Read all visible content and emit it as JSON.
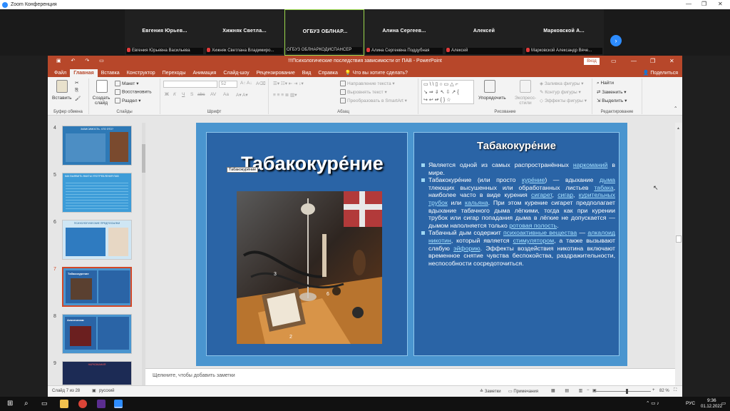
{
  "zoom": {
    "title": "Zoom Конференция",
    "participants": [
      {
        "name": "Евгения  Юрьев...",
        "label": "Евгения Юрьевна Васильева"
      },
      {
        "name": "Хижняк  Светла...",
        "label": "Хижняк Светлана Владимиро..."
      },
      {
        "name": "ОГБУЗ  ОБЛНАР...",
        "label": "ОГБУЗ ОБЛНАРКОДИСПАНСЕР"
      },
      {
        "name": "Алина  Сергеев...",
        "label": "Алина Сергеевна Поддубная"
      },
      {
        "name": "Алексей",
        "label": "Алексей"
      },
      {
        "name": "Марковской  А...",
        "label": "Марковской Александр Вяче..."
      }
    ],
    "next_icon": "chevron-right-icon"
  },
  "ppt": {
    "window_title": "!!!Психологические последствия зависимости от ПАВ  -  PowerPoint",
    "login": "Вход",
    "tabs": [
      "Файл",
      "Главная",
      "Вставка",
      "Конструктор",
      "Переходы",
      "Анимация",
      "Слайд-шоу",
      "Рецензирование",
      "Вид",
      "Справка"
    ],
    "tell_me": "Что вы хотите сделать?",
    "share": "Поделиться",
    "ribbon": {
      "clipboard": {
        "paste": "Вставить",
        "label": "Буфер обмена"
      },
      "slides": {
        "create": "Создать слайд",
        "layout": "Макет",
        "reset": "Восстановить",
        "section": "Раздел",
        "label": "Слайды"
      },
      "font": {
        "size": "52",
        "label": "Шрифт",
        "buttons": [
          "Ж",
          "К",
          "Ч",
          "S",
          "abc",
          "AV",
          "Aa"
        ]
      },
      "paragraph": {
        "direction": "Направление текста",
        "align": "Выровнять текст",
        "smartart": "Преобразовать в SmartArt",
        "label": "Абзац"
      },
      "drawing": {
        "arrange": "Упорядочить",
        "styles": "Экспресс-стили",
        "fill": "Заливка фигуры",
        "outline": "Контур фигуры",
        "effects": "Эффекты фигуры",
        "label": "Рисование"
      },
      "editing": {
        "find": "Найти",
        "replace": "Заменить",
        "select": "Выделить",
        "label": "Редактирование"
      }
    },
    "thumbnails": [
      {
        "num": "4",
        "title": "ЗАВИСИМОСТЬ. ЧТО ЭТО?"
      },
      {
        "num": "5",
        "title": "КАК ВЫЯВИТЬ ФАКТЫ УПОТРЕБЛЕНИЯ ПАВ"
      },
      {
        "num": "6",
        "title": "ПСИХОЛОГИЧЕСКИЕ ПРЕДПОСЫЛКИ"
      },
      {
        "num": "7",
        "title": "Табакокурение"
      },
      {
        "num": "8",
        "title": "Алкоголизм"
      },
      {
        "num": "9",
        "title": "НАРКОМАНИЯ"
      }
    ],
    "slide": {
      "title": "Табакокуре́ние",
      "tooltip": "Табакокуре́ние",
      "right_title": "Табакокуре́ние",
      "bullets": [
        [
          {
            "t": "Является одной из самых распространённых "
          },
          {
            "t": "наркоманий",
            "l": true
          },
          {
            "t": " в мире."
          }
        ],
        [
          {
            "t": "Табакокуре́ние (или просто "
          },
          {
            "t": "куре́ние",
            "l": true
          },
          {
            "t": ") — вдыхание "
          },
          {
            "t": "дыма",
            "l": true
          },
          {
            "t": " тлеющих высушенных или обработанных листьев "
          },
          {
            "t": "табака",
            "l": true
          },
          {
            "t": ", наиболее часто в виде курения "
          },
          {
            "t": "сигарет",
            "l": true
          },
          {
            "t": ", "
          },
          {
            "t": "сигар",
            "l": true
          },
          {
            "t": ", "
          },
          {
            "t": "курительных трубок",
            "l": true
          },
          {
            "t": " или "
          },
          {
            "t": "кальяна",
            "l": true
          },
          {
            "t": ". При этом курение сигарет предполагает вдыхание табачного дыма лёгкими, тогда как при курении трубок или сигар попадания дыма в лёгкие не допускается — дымом наполняется только "
          },
          {
            "t": "ротовая полость",
            "l": true
          },
          {
            "t": "."
          }
        ],
        [
          {
            "t": "Табачный дым содержит "
          },
          {
            "t": "психоактивные вещества",
            "l": true
          },
          {
            "t": " — "
          },
          {
            "t": "алкалоид",
            "l": true
          },
          {
            "t": " "
          },
          {
            "t": "никотин",
            "l": true
          },
          {
            "t": ", который является "
          },
          {
            "t": "стимулятором",
            "l": true
          },
          {
            "t": ", а также вызывают слабую "
          },
          {
            "t": "эйфорию",
            "l": true
          },
          {
            "t": ". Эффекты воздействия никотина включают временное снятие чувства беспокойства, раздражительности, неспособности сосредоточиться."
          }
        ]
      ]
    },
    "notes_placeholder": "Щелкните, чтобы добавить заметки",
    "status": {
      "slide": "Слайд 7 из 28",
      "lang": "русский",
      "notes": "Заметки",
      "comments": "Примечания",
      "zoom": "82 %"
    }
  },
  "taskbar": {
    "search": "⌕",
    "lang": "РУС",
    "time": "9:36",
    "date": "01.12.2022"
  }
}
